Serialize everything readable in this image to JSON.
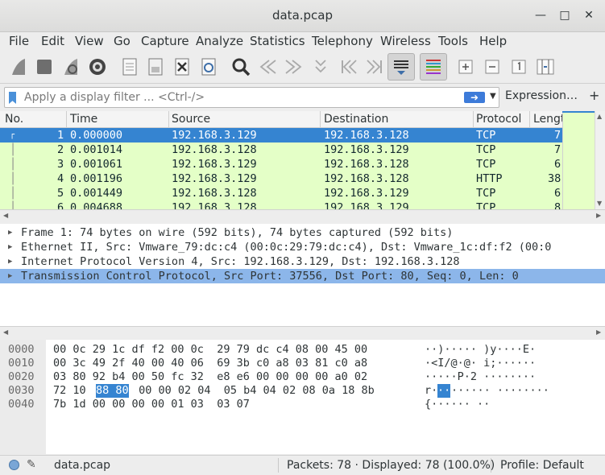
{
  "window": {
    "title": "data.pcap"
  },
  "menu": [
    "File",
    "Edit",
    "View",
    "Go",
    "Capture",
    "Analyze",
    "Statistics",
    "Telephony",
    "Wireless",
    "Tools",
    "Help"
  ],
  "toolbar_icons": [
    "start-capture-icon",
    "stop-capture-icon",
    "restart-capture-icon",
    "capture-options-icon",
    "open-file-icon",
    "save-file-icon",
    "close-file-icon",
    "reload-file-icon",
    "find-packet-icon",
    "go-back-icon",
    "go-forward-icon",
    "go-to-packet-icon",
    "first-packet-icon",
    "last-packet-icon",
    "auto-scroll-icon",
    "colorize-icon",
    "zoom-in-icon",
    "zoom-out-icon",
    "normal-size-icon",
    "resize-columns-icon"
  ],
  "filter": {
    "placeholder": "Apply a display filter ... <Ctrl-/>",
    "value": "",
    "expression_label": "Expression…",
    "add_label": "+"
  },
  "packet_list": {
    "columns": [
      "No.",
      "Time",
      "Source",
      "Destination",
      "Protocol",
      "Lengt"
    ],
    "rows": [
      {
        "no": "1",
        "time": "0.000000",
        "source": "192.168.3.129",
        "destination": "192.168.3.128",
        "protocol": "TCP",
        "length": "7"
      },
      {
        "no": "2",
        "time": "0.001014",
        "source": "192.168.3.128",
        "destination": "192.168.3.129",
        "protocol": "TCP",
        "length": "7"
      },
      {
        "no": "3",
        "time": "0.001061",
        "source": "192.168.3.129",
        "destination": "192.168.3.128",
        "protocol": "TCP",
        "length": "6"
      },
      {
        "no": "4",
        "time": "0.001196",
        "source": "192.168.3.129",
        "destination": "192.168.3.128",
        "protocol": "HTTP",
        "length": "38"
      },
      {
        "no": "5",
        "time": "0.001449",
        "source": "192.168.3.128",
        "destination": "192.168.3.129",
        "protocol": "TCP",
        "length": "6"
      },
      {
        "no": "6",
        "time": "0.004688",
        "source": "192.168.3.128",
        "destination": "192.168.3.129",
        "protocol": "TCP",
        "length": "8"
      }
    ]
  },
  "details": [
    "Frame 1: 74 bytes on wire (592 bits), 74 bytes captured (592 bits)",
    "Ethernet II, Src: Vmware_79:dc:c4 (00:0c:29:79:dc:c4), Dst: Vmware_1c:df:f2 (00:0",
    "Internet Protocol Version 4, Src: 192.168.3.129, Dst: 192.168.3.128",
    "Transmission Control Protocol, Src Port: 37556, Dst Port: 80, Seq: 0, Len: 0"
  ],
  "bytes": [
    {
      "offset": "0000",
      "pre": "00 0c 29 1c df f2 00 0c  29 79 dc c4 08 00 45 00",
      "hl": "",
      "post": "",
      "ascii": "··)····· )y····E·"
    },
    {
      "offset": "0010",
      "pre": "00 3c 49 2f 40 00 40 06  69 3b c0 a8 03 81 c0 a8",
      "hl": "",
      "post": "",
      "ascii": "·<I/@·@· i;······"
    },
    {
      "offset": "0020",
      "pre": "03 80 92 b4 00 50 fc 32  e8 e6 00 00 00 00 a0 02",
      "hl": "",
      "post": "",
      "ascii": "·····P·2 ········"
    },
    {
      "offset": "0030",
      "pre": "72 10 ",
      "hl": "88 80",
      "post": " 00 00 02 04  05 b4 04 02 08 0a 18 8b",
      "ascii_pre": "r·",
      "ascii_hl": "··",
      "ascii_post": "······ ········"
    },
    {
      "offset": "0040",
      "pre": "7b 1d 00 00 00 00 01 03  03 07",
      "hl": "",
      "post": "",
      "ascii": "{······ ··"
    }
  ],
  "status": {
    "file": "data.pcap",
    "packets": "Packets: 78 · Displayed: 78 (100.0%)",
    "profile": "Profile: Default"
  },
  "colors": {
    "selected": "#3584d1",
    "tcp_row": "#e4ffc7",
    "detail_selected": "#8cb6ea"
  }
}
